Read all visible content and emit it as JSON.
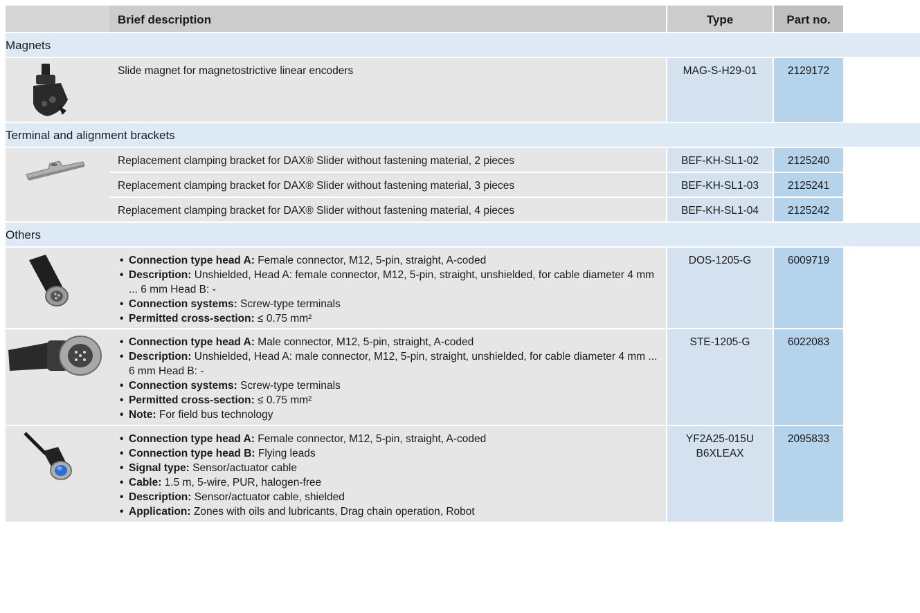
{
  "header": {
    "desc": "Brief description",
    "type": "Type",
    "part": "Part no."
  },
  "sections": [
    {
      "title": "Magnets",
      "rows": [
        {
          "image": "slide-magnet-image",
          "desc": "Slide magnet for magnetostrictive linear encoders",
          "type": "MAG-S-H29-01",
          "part": "2129172"
        }
      ]
    },
    {
      "title": "Terminal and alignment brackets",
      "rows": [
        {
          "image": "clamping-bracket-image",
          "desc": "Replacement clamping bracket for DAX® Slider without fastening material, 2 pieces",
          "type": "BEF-KH-SL1-02",
          "part": "2125240"
        },
        {
          "desc": "Replacement clamping bracket for DAX® Slider without fastening material, 3 pieces",
          "type": "BEF-KH-SL1-03",
          "part": "2125241"
        },
        {
          "desc": "Replacement clamping bracket for DAX® Slider without fastening material, 4 pieces",
          "type": "BEF-KH-SL1-04",
          "part": "2125242"
        }
      ]
    },
    {
      "title": "Others",
      "rows": [
        {
          "image": "female-connector-image",
          "bullets": [
            {
              "label": "Connection type head A:",
              "text": " Female connector, M12, 5-pin, straight, A-coded"
            },
            {
              "label": "Description:",
              "text": " Unshielded, Head A: female connector, M12, 5-pin, straight, unshielded, for cable diameter 4 mm ... 6 mm Head B: -"
            },
            {
              "label": "Connection systems:",
              "text": " Screw-type terminals"
            },
            {
              "label": "Permitted cross-section:",
              "text": " ≤ 0.75 mm²"
            }
          ],
          "type": "DOS-1205-G",
          "part": "6009719"
        },
        {
          "image": "male-connector-image",
          "bullets": [
            {
              "label": "Connection type head A:",
              "text": " Male connector, M12, 5-pin, straight, A-coded"
            },
            {
              "label": "Description:",
              "text": " Unshielded, Head A: male connector, M12, 5-pin, straight, unshielded, for cable diameter 4 mm ... 6 mm Head B: -"
            },
            {
              "label": "Connection systems:",
              "text": " Screw-type terminals"
            },
            {
              "label": "Permitted cross-section:",
              "text": " ≤ 0.75 mm²"
            },
            {
              "label": "Note:",
              "text": " For field bus technology"
            }
          ],
          "type": "STE-1205-G",
          "part": "6022083"
        },
        {
          "image": "sensor-cable-image",
          "bullets": [
            {
              "label": "Connection type head A:",
              "text": " Female connector, M12, 5-pin, straight, A-coded"
            },
            {
              "label": "Connection type head B:",
              "text": " Flying leads"
            },
            {
              "label": "Signal type:",
              "text": " Sensor/actuator cable"
            },
            {
              "label": "Cable:",
              "text": " 1.5 m, 5-wire, PUR, halogen-free"
            },
            {
              "label": "Description:",
              "text": " Sensor/actuator cable, shielded"
            },
            {
              "label": "Application:",
              "text": " Zones with oils and lubricants, Drag chain operation, Robot"
            }
          ],
          "type": "YF2A25-015UB6XLEAX",
          "part": "2095833"
        }
      ]
    }
  ]
}
